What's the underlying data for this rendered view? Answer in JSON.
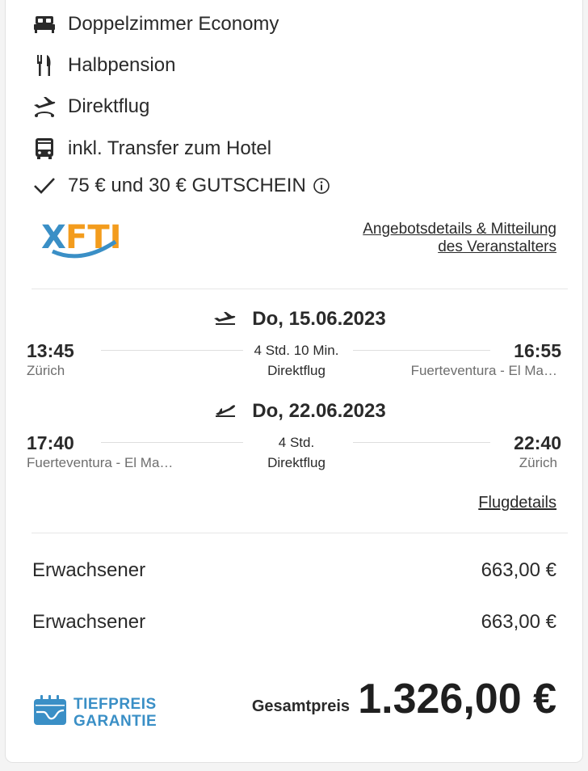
{
  "features": [
    {
      "icon": "bed-icon",
      "label": "Doppelzimmer Economy"
    },
    {
      "icon": "cutlery-icon",
      "label": "Halbpension"
    },
    {
      "icon": "plane-departure-icon",
      "label": "Direktflug"
    },
    {
      "icon": "bus-icon",
      "label": "inkl. Transfer zum Hotel"
    },
    {
      "icon": "checkmark-icon",
      "label": "75 € und 30 € GUTSCHEIN"
    }
  ],
  "offer_link": {
    "line1": "Angebotsdetails & Mitteilung",
    "line2": "des Veranstalters"
  },
  "outbound": {
    "date": "Do, 15.06.2023",
    "dep_time": "13:45",
    "dep_place": "Zürich",
    "duration": "4 Std. 10 Min.",
    "type": "Direktflug",
    "arr_time": "16:55",
    "arr_place": "Fuerteventura - El Ma…"
  },
  "return": {
    "date": "Do, 22.06.2023",
    "dep_time": "17:40",
    "dep_place": "Fuerteventura - El Ma…",
    "duration": "4 Std.",
    "type": "Direktflug",
    "arr_time": "22:40",
    "arr_place": "Zürich"
  },
  "flight_details_label": "Flugdetails",
  "passengers": [
    {
      "label": "Erwachsener",
      "price": "663,00 €"
    },
    {
      "label": "Erwachsener",
      "price": "663,00 €"
    }
  ],
  "badge": {
    "line1": "TIEFPREIS",
    "line2": "GARANTIE"
  },
  "total": {
    "label": "Gesamtpreis",
    "value": "1.326,00 €"
  },
  "colors": {
    "accent": "#3a8fc6",
    "logo_orange": "#f39c1d"
  }
}
